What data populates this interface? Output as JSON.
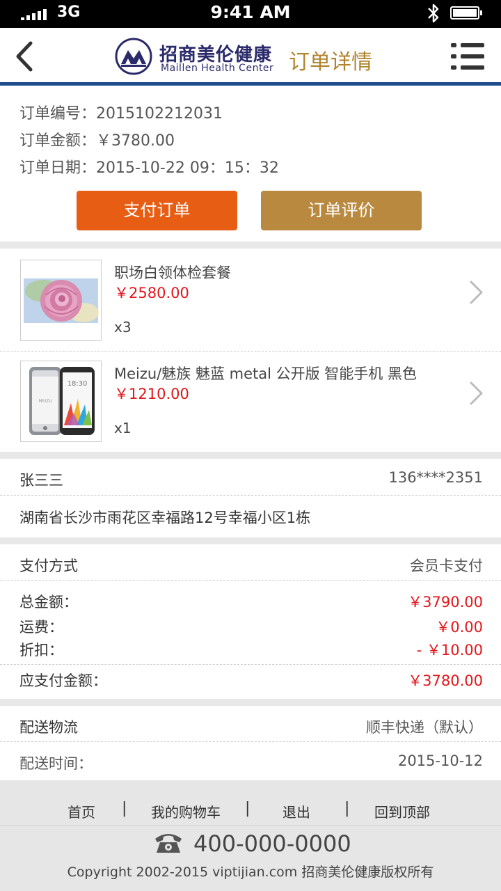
{
  "status_bar": {
    "network": "3G",
    "time": "9:41 AM"
  },
  "header": {
    "brand_cn": "招商美伦健康",
    "brand_en": "Maillen Health Center",
    "title": "订单详情"
  },
  "order": {
    "number": "订单编号：2015102212031",
    "amount": "订单金额：￥3780.00",
    "date": "订单日期：2015-10-22  09：15：32",
    "pay_label": "支付订单",
    "review_label": "订单评价"
  },
  "products": [
    {
      "name": "职场白领体检套餐",
      "price": "￥2580.00",
      "qty": "x3"
    },
    {
      "name": "Meizu/魅族 魅蓝 metal 公开版 智能手机     黑色",
      "price": "￥1210.00",
      "qty": "x1",
      "screen_time": "18:30",
      "brand_mark": "MEIZU"
    }
  ],
  "address": {
    "name": "张三三",
    "phone": "136****2351",
    "detail": "湖南省长沙市雨花区幸福路12号幸福小区1栋"
  },
  "payment": {
    "method_label": "支付方式",
    "method_value": "会员卡支付",
    "total_label": "总金额：",
    "total_value": "￥3790.00",
    "freight_label": "运费：",
    "freight_value": "￥0.00",
    "discount_label": "折扣：",
    "discount_value": "- ￥10.00",
    "payable_label": "应支付金额：",
    "payable_value": "￥3780.00"
  },
  "delivery": {
    "label": "配送物流",
    "value": "顺丰快递（默认）",
    "time_label": "配送时间：",
    "time_value": "2015-10-12"
  },
  "footer": {
    "nav": [
      "首页",
      "我的购物车",
      "退出",
      "回到顶部"
    ],
    "separator": "|",
    "phone": "400-000-0000",
    "copyright": "Copyright 2002-2015 viptijian.com  招商美伦健康版权所有"
  },
  "colors": {
    "accent_orange": "#e85d14",
    "accent_gold": "#b8893f",
    "price_red": "#e4161b",
    "header_line": "#1f4d8e",
    "title_gold": "#b0832c"
  }
}
